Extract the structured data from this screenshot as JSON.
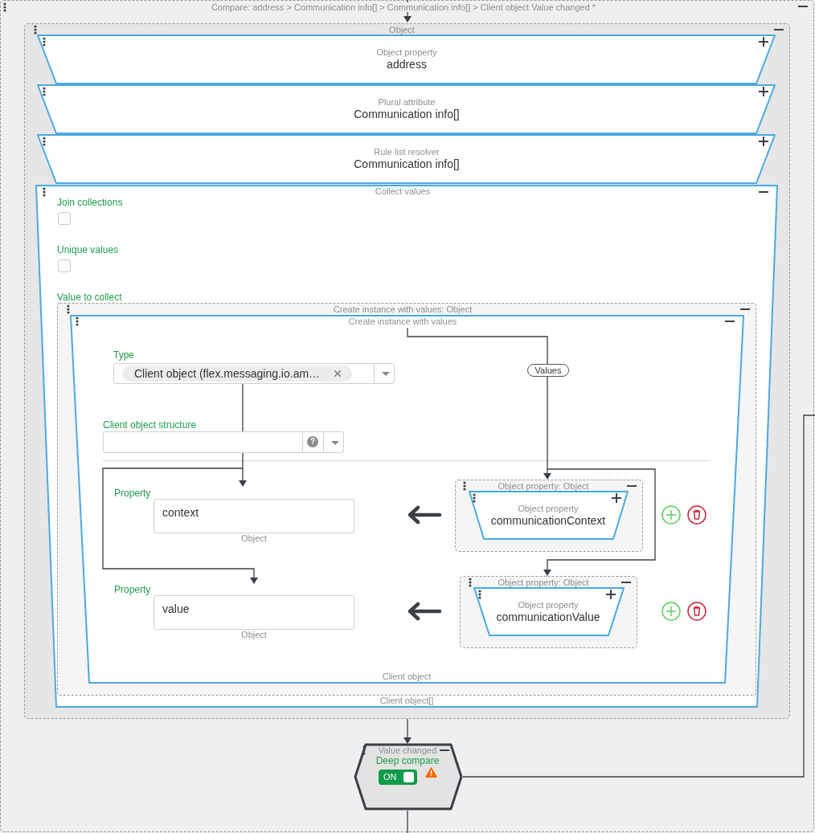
{
  "header": {
    "title": "Compare: address > Communication info[] > Communication info[] > Client object Value changed *",
    "expanded": true
  },
  "object_group": {
    "title": "Object",
    "expanded": true,
    "chain": [
      {
        "caption": "Object property",
        "value": "address",
        "expanded": false
      },
      {
        "caption": "Plural attribute",
        "value": "Communication info[]",
        "expanded": false
      },
      {
        "caption": "Rule list resolver",
        "value": "Communication info[]",
        "expanded": false
      }
    ],
    "collect": {
      "title": "Collect values",
      "expanded": true,
      "footer": "Client object[]",
      "options": [
        {
          "label": "Join collections",
          "checked": false
        },
        {
          "label": "Unique values",
          "checked": false
        }
      ],
      "value_label": "Value to collect",
      "instance_group": {
        "title": "Create instance with values: Object",
        "expanded": true
      },
      "instance": {
        "title": "Create instance with values",
        "expanded": true,
        "footer": "Client object",
        "type": {
          "label": "Type",
          "chip": "Client object (flex.messaging.io.am…"
        },
        "structure": {
          "label": "Client object structure",
          "help": "?"
        },
        "values_tag": "Values",
        "properties": [
          {
            "label": "Property",
            "value": "context",
            "type": "Object",
            "group_title": "Object property: Object",
            "group_expanded": true,
            "caption": "Object property",
            "node_value": "communicationContext",
            "expanded": false
          },
          {
            "label": "Property",
            "value": "value",
            "type": "Object",
            "group_title": "Object property: Object",
            "group_expanded": true,
            "caption": "Object property",
            "node_value": "communicationValue",
            "expanded": false
          }
        ]
      }
    }
  },
  "compare": {
    "title": "Value changed",
    "expanded": true,
    "label": "Deep compare",
    "toggle": {
      "on": true,
      "text": "ON"
    },
    "warning": true
  }
}
